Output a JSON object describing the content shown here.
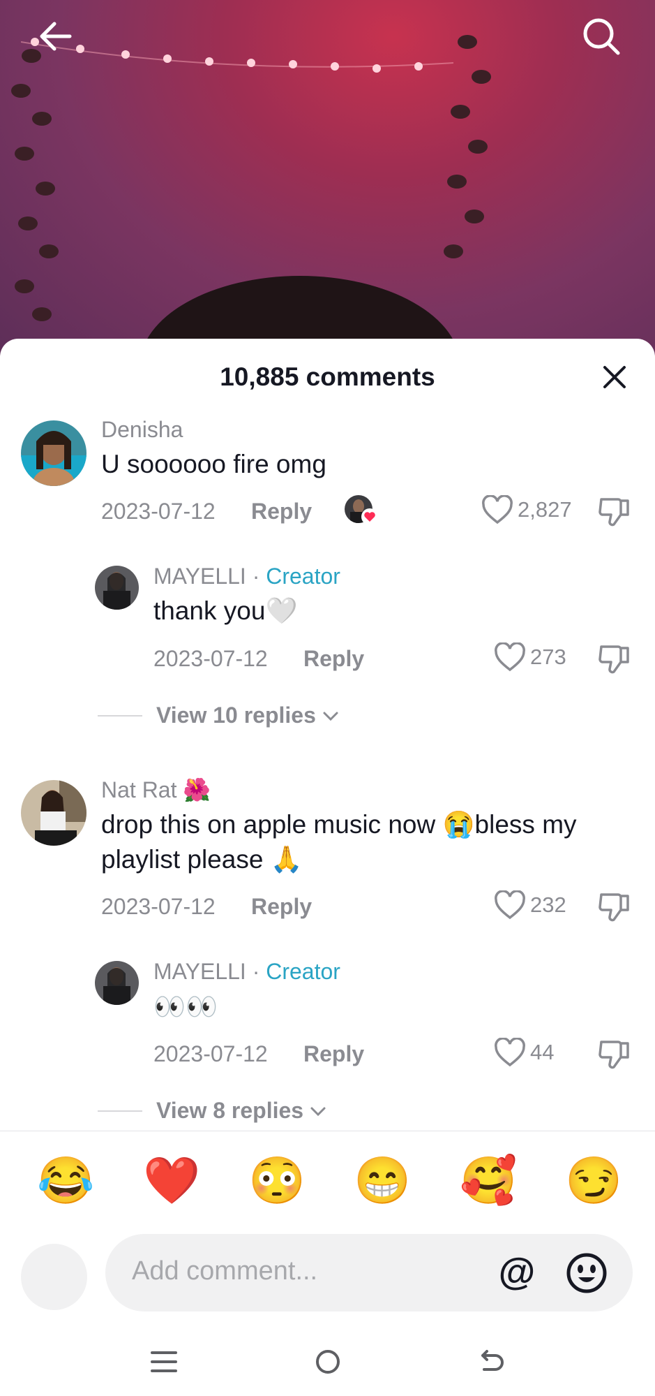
{
  "header": {
    "back_icon": "arrow-left-icon",
    "search_icon": "search-icon"
  },
  "sheet": {
    "title": "10,885 comments",
    "close_icon": "close-icon"
  },
  "comments": [
    {
      "name": "Denisha",
      "text": "U soooooo fire omg",
      "date": "2023-07-12",
      "reply_label": "Reply",
      "likes": "2,827",
      "creator_liked": true,
      "replies": [
        {
          "name": "MAYELLI",
          "badge_sep": "·",
          "badge": "Creator",
          "text": "thank you🤍",
          "date": "2023-07-12",
          "reply_label": "Reply",
          "likes": "273"
        }
      ],
      "view_replies": "View 10 replies"
    },
    {
      "name": "Nat Rat 🌺",
      "text_line1": "drop this on apple music now 😭bless my",
      "text_line2": "playlist please 🙏",
      "date": "2023-07-12",
      "reply_label": "Reply",
      "likes": "232",
      "replies": [
        {
          "name": "MAYELLI",
          "badge_sep": "·",
          "badge": "Creator",
          "text": "👀👀",
          "date": "2023-07-12",
          "reply_label": "Reply",
          "likes": "44"
        }
      ],
      "view_replies": "View 8 replies"
    }
  ],
  "emoji_bar": [
    "😂",
    "❤️",
    "😳",
    "😁",
    "🥰",
    "😏"
  ],
  "composer": {
    "placeholder": "Add comment...",
    "at_label": "@",
    "emoji_icon": "smile-icon"
  },
  "system_nav": [
    "menu-icon",
    "home-circle-icon",
    "back-icon"
  ],
  "colors": {
    "creator_accent": "#2aa4c4",
    "text_primary": "#161823",
    "text_secondary": "#8a8b91",
    "like_badge": "#fe2c55"
  }
}
